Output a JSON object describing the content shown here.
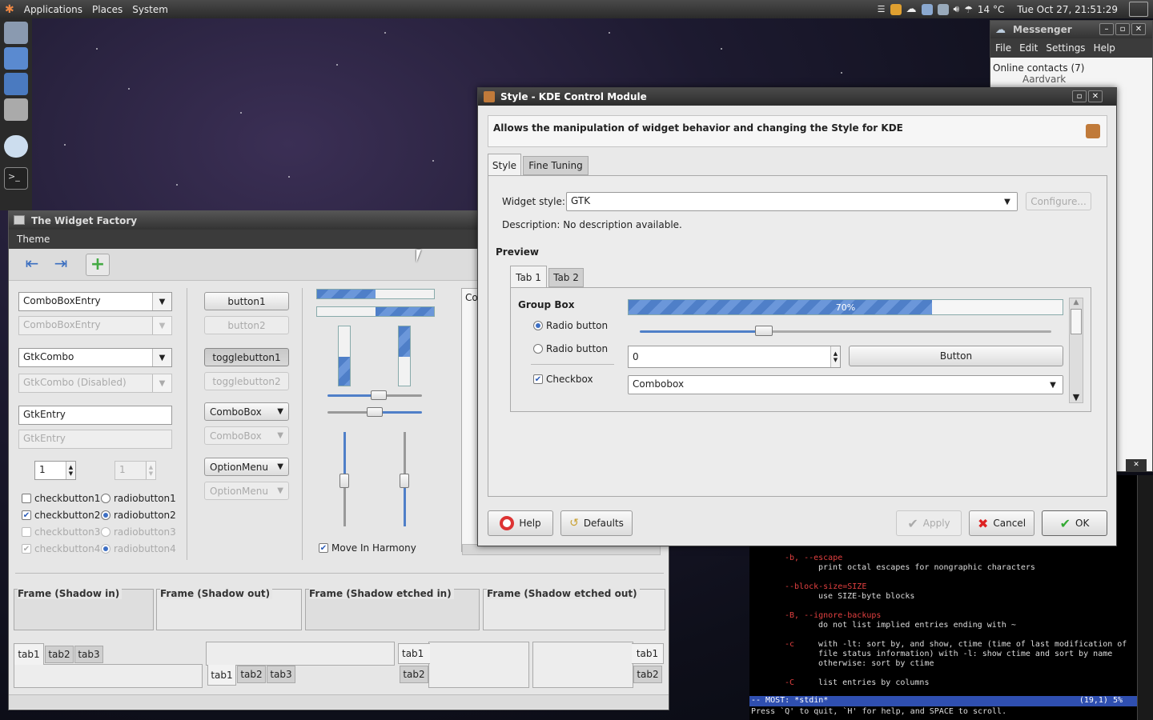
{
  "top_panel": {
    "menus": [
      "Applications",
      "Places",
      "System"
    ],
    "weather": "14 °C",
    "clock": "Tue Oct 27, 21:51:29"
  },
  "widget_factory": {
    "title": "The Widget Factory",
    "menu": "Theme",
    "col1": {
      "combo_entry": "ComboBoxEntry",
      "combo_entry_dis": "ComboBoxEntry",
      "gtk_combo": "GtkCombo",
      "gtk_combo_dis": "GtkCombo (Disabled)",
      "gtk_entry": "GtkEntry",
      "gtk_entry_dis": "GtkEntry",
      "spin": "1",
      "spin_dis": "1",
      "check1": "checkbutton1",
      "check2": "checkbutton2",
      "check3": "checkbutton3",
      "check4": "checkbutton4",
      "radio1": "radiobutton1",
      "radio2": "radiobutton2",
      "radio3": "radiobutton3",
      "radio4": "radiobutton4"
    },
    "col2": {
      "button1": "button1",
      "button2": "button2",
      "toggle1": "togglebutton1",
      "toggle2": "togglebutton2",
      "combobox": "ComboBox",
      "combobox_dis": "ComboBox",
      "optionmenu": "OptionMenu",
      "optionmenu_dis": "OptionMenu"
    },
    "harmony_label": "Move In Harmony",
    "partial_label": "Co",
    "frames": [
      "Frame (Shadow in)",
      "Frame (Shadow out)",
      "Frame (Shadow etched in)",
      "Frame (Shadow etched out)"
    ],
    "tabs": [
      "tab1",
      "tab2",
      "tab3"
    ]
  },
  "kde_dialog": {
    "title": "Style - KDE Control Module",
    "header": "Allows the manipulation of widget behavior and changing the Style for KDE",
    "tabs": [
      "Style",
      "Fine Tuning"
    ],
    "widget_style_label": "Widget style:",
    "widget_style_value": "GTK",
    "configure": "Configure...",
    "description": "Description: No description available.",
    "preview_label": "Preview",
    "preview_tabs": [
      "Tab 1",
      "Tab 2"
    ],
    "group_box": "Group Box",
    "progress_text": "70%",
    "progress_value": 0.7,
    "radio1": "Radio button",
    "radio2": "Radio button",
    "checkbox": "Checkbox",
    "spin_value": "0",
    "button": "Button",
    "combobox": "Combobox",
    "buttons": {
      "help": "Help",
      "defaults": "Defaults",
      "apply": "Apply",
      "cancel": "Cancel",
      "ok": "OK"
    }
  },
  "messenger": {
    "title": "Messenger",
    "menus": [
      "File",
      "Edit",
      "Settings",
      "Help"
    ],
    "online": "Online contacts (7)",
    "contact": "Aardvark"
  },
  "terminal": {
    "lines": [
      {
        "opt": "-b, --escape",
        "desc": "print octal escapes for nongraphic characters"
      },
      {
        "opt": "--block-size=SIZE",
        "desc": "use SIZE-byte blocks"
      },
      {
        "opt": "-B, --ignore-backups",
        "desc": "do not list implied entries ending with ~"
      },
      {
        "opt": "-c",
        "desc": "with -lt: sort by, and show, ctime (time of last modification of"
      },
      {
        "opt": "",
        "desc": "file status information) with -l: show ctime and  sort  by  name"
      },
      {
        "opt": "",
        "desc": "otherwise: sort by ctime"
      },
      {
        "opt": "-C",
        "desc": "list entries by columns"
      }
    ],
    "status_left": "-- MOST: *stdin*",
    "status_right": "(19,1) 5%",
    "hint": "Press `Q' to quit, `H' for help, and SPACE to scroll."
  }
}
